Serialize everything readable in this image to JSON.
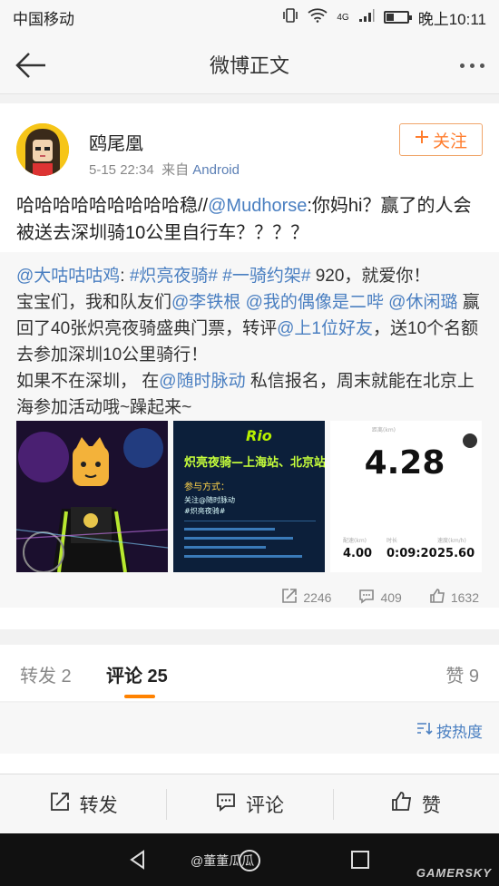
{
  "status": {
    "carrier": "中国移动",
    "network": "4G",
    "time": "晚上10:11"
  },
  "nav": {
    "title": "微博正文"
  },
  "post": {
    "username": "鸥尾凰",
    "time": "5-15 22:34",
    "from": "来自",
    "source": "Android",
    "follow_label": "关注",
    "text_a": "哈哈哈哈哈哈哈哈哈稳//",
    "mention": "@Mudhorse",
    "text_b": ":你妈hi？赢了的人会被送去深圳骑10公里自行车？？？？"
  },
  "repost": {
    "author": "@大咕咕咕鸡",
    "tag1": "#炽亮夜骑#",
    "tag2": "#一骑约架#",
    "line1_tail": " 920，就爱你！",
    "line2a": "宝宝们，我和队友们",
    "m1": "@李铁根",
    "m2": "@我的偶像是二哔",
    "m3": "@休闲璐",
    "line3a": " 赢回了40张炽亮夜骑盛典门票，转评",
    "m4": "@上1位好友",
    "line3b": "，送10个名额去参加深圳10公里骑行！",
    "line4a": "如果不在深圳， 在",
    "m5": "@随时脉动",
    "line4b": " 私信报名，周末就能在北京上海参加活动哦~躁起来~",
    "img2": {
      "brand": "Rio",
      "heading": "炽亮夜骑—上海站、北京站",
      "sub": "参与方式：",
      "line1": "关注@随时脉动",
      "line2": "#炽亮夜骑#"
    },
    "img3": {
      "distance": "4.28",
      "label_top": "距离(km)",
      "m1_label": "配速(km)",
      "m1": "4.00",
      "m2_label": "时长",
      "m2": "0:09:20",
      "m3_label": "速度(km/h)",
      "m3": "25.60"
    },
    "stats": {
      "reposts": "2246",
      "comments": "409",
      "likes": "1632"
    }
  },
  "tabs": {
    "repost": "转发 2",
    "comment": "评论 25",
    "like": "赞 9"
  },
  "sort_label": "按热度",
  "actions": {
    "repost": "转发",
    "comment": "评论",
    "like": "赞"
  },
  "watermark": "@董董瓜瓜",
  "site_mark": "GAMERSKY"
}
